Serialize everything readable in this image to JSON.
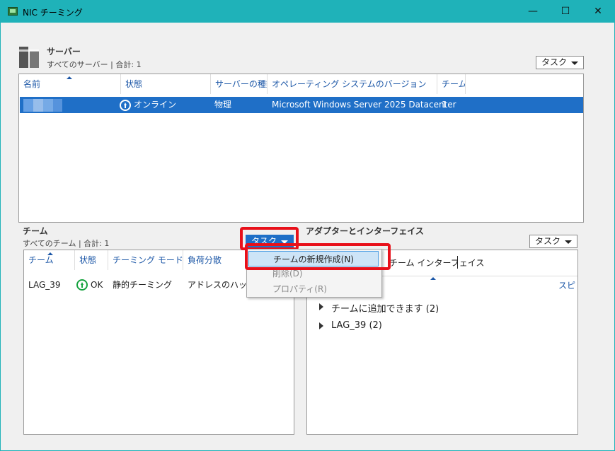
{
  "window": {
    "title": "NIC チーミング",
    "minimize_glyph": "—",
    "maximize_glyph": "☐",
    "close_glyph": "✕"
  },
  "servers": {
    "title": "サーバー",
    "subtitle": "すべてのサーバー | 合計: 1",
    "task_label": "タスク",
    "columns": [
      "名前",
      "状態",
      "サーバーの種類",
      "オペレーティング システムのバージョン",
      "チーム"
    ],
    "rows": [
      {
        "name": "",
        "status": "オンライン",
        "type": "物理",
        "os": "Microsoft Windows Server 2025 Datacenter",
        "teams": "1"
      }
    ]
  },
  "teams": {
    "title": "チーム",
    "subtitle": "すべてのチーム | 合計: 1",
    "task_label": "タスク",
    "columns": [
      "チーム",
      "状態",
      "チーミング モード",
      "負荷分散"
    ],
    "rows": [
      {
        "team": "LAG_39",
        "status": "OK",
        "mode": "静的チーミング",
        "lb": "アドレスのハッシュ"
      }
    ]
  },
  "adapters": {
    "title": "アダプターとインターフェイス",
    "task_label": "タスク",
    "tab_label": "チーム インターフェイス",
    "column_right": "スピ",
    "tree": [
      {
        "label": "チームに追加できます (2)"
      },
      {
        "label": "LAG_39 (2)"
      }
    ]
  },
  "context_menu": {
    "items": [
      {
        "label": "チームの新規作成(N)",
        "state": "highlighted"
      },
      {
        "label": "削除(D)",
        "state": "disabled"
      },
      {
        "label": "プロパティ(R)",
        "state": "disabled"
      }
    ]
  },
  "colors": {
    "accent": "#1fb2b9",
    "selection": "#1f6fc7",
    "highlight_box": "#e8101a",
    "status_ok": "#16a33f"
  }
}
